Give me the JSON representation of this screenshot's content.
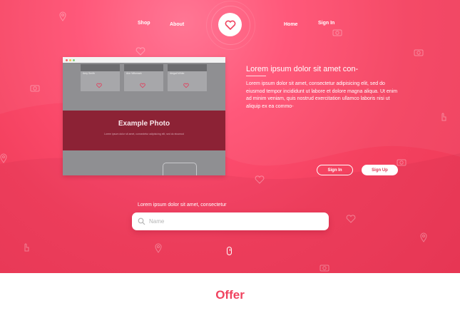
{
  "nav": {
    "shop": "Shop",
    "about": "About",
    "home": "Home",
    "signin": "Sign In"
  },
  "browser_preview": {
    "cards": [
      {
        "name": "Amy Smith"
      },
      {
        "name": "Ann Wilsmark"
      },
      {
        "name": "Abigail White"
      }
    ],
    "example_title": "Example Photo",
    "example_text": "Lorem ipsum dolor sit amet, consectetur adipisicing elit, sed do eiusmod"
  },
  "hero": {
    "title": "Lorem ipsum dolor sit amet con-",
    "text": "Lorem ipsum dolor sit amet, consectetur adipisicing elit, sed do eiusmod tempor incididunt ut labore et dolore magna aliqua. Ut enim ad minim veniam, quis nostrud exercitation ullamco laboris nisi ut aliquip ex ea commo-",
    "signin_button": "Sign In",
    "signup_button": "Sign Up"
  },
  "search": {
    "label": "Lorem ipsum dolor sit amet, consectetur",
    "placeholder": "Name"
  },
  "offer": {
    "title": "Offer"
  },
  "colors": {
    "brand": "#f0435f",
    "hero_bg": "#ff5073",
    "white": "#ffffff"
  }
}
